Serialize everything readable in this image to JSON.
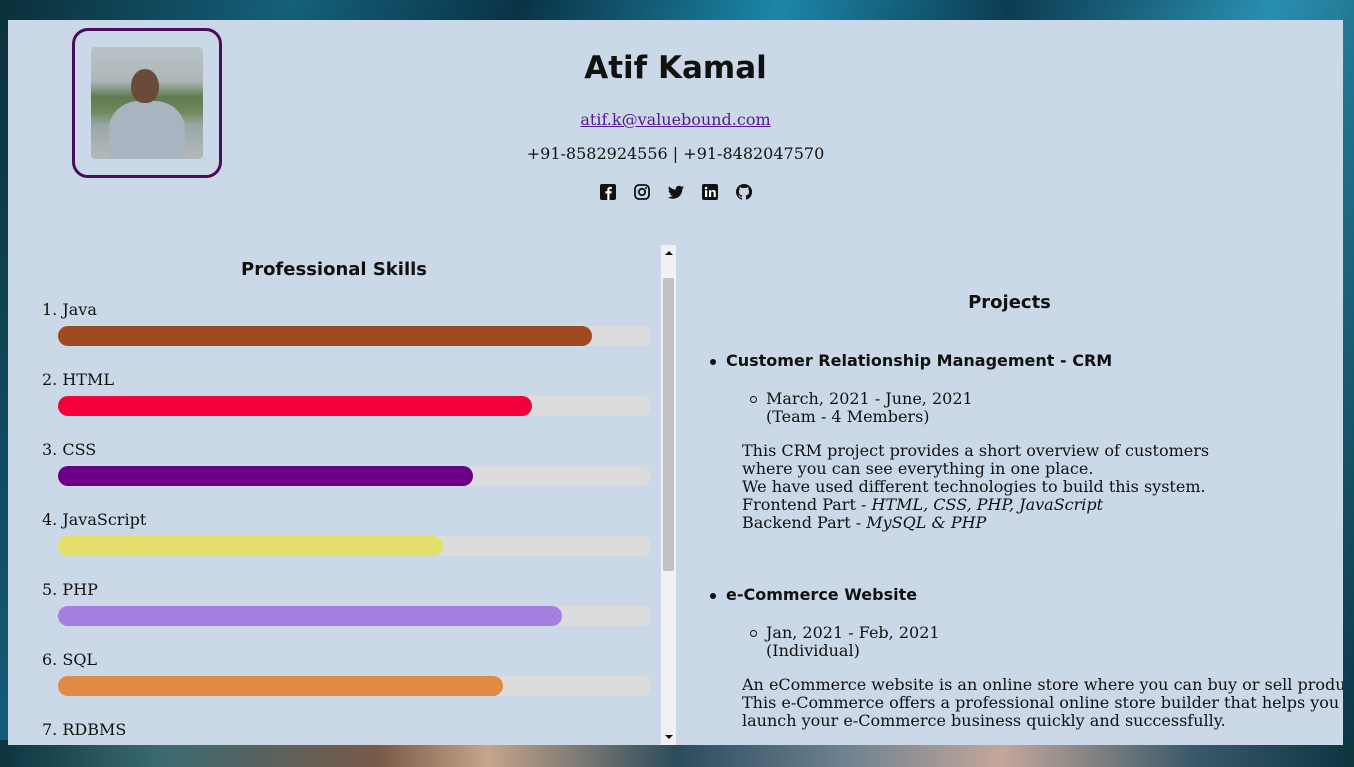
{
  "profile": {
    "name": "Atif Kamal",
    "email": "atif.k@valuebound.com",
    "phone": "+91-8582924556 | +91-8482047570",
    "photo_alt": "profile photo",
    "socials": [
      "facebook-icon",
      "instagram-icon",
      "twitter-icon",
      "linkedin-icon",
      "github-icon"
    ]
  },
  "skills": {
    "title": "Professional Skills",
    "items": [
      {
        "label": "1. Java",
        "level_pct": 90,
        "color": "#a04a22"
      },
      {
        "label": "2. HTML",
        "level_pct": 80,
        "color": "#f5003a"
      },
      {
        "label": "3. CSS",
        "level_pct": 70,
        "color": "#6a008a"
      },
      {
        "label": "4. JavaScript",
        "level_pct": 65,
        "color": "#e2e06a"
      },
      {
        "label": "5. PHP",
        "level_pct": 85,
        "color": "#a67fe0"
      },
      {
        "label": "6. SQL",
        "level_pct": 75,
        "color": "#e08a44"
      },
      {
        "label": "7. RDBMS",
        "level_pct": 0,
        "color": "#cccccc"
      }
    ]
  },
  "projects": {
    "title": "Projects",
    "items": [
      {
        "title": "Customer Relationship Management - CRM",
        "dates": "March, 2021 - June, 2021",
        "team": "(Team - 4 Members)",
        "desc_1": "This CRM project provides a short overview of customers",
        "desc_2": "where you can see everything in one place.",
        "desc_3": "We have used different technologies to build this system.",
        "frontend_prefix": "Frontend Part - ",
        "frontend": "HTML, CSS, PHP, JavaScript",
        "backend_prefix": "Backend Part - ",
        "backend": "MySQL & PHP"
      },
      {
        "title": "e-Commerce Website",
        "dates": "Jan, 2021 - Feb, 2021",
        "team": "(Individual)",
        "desc_1": "An eCommerce website is an online store where you can buy or sell products online.",
        "desc_2": "This e-Commerce offers a professional online store builder that helps you",
        "desc_3": "launch your e-Commerce business quickly and successfully."
      }
    ]
  },
  "colors": {
    "page_bg": "#cbd8e8",
    "photo_border": "#4a0d5e",
    "link": "#551a8b"
  }
}
